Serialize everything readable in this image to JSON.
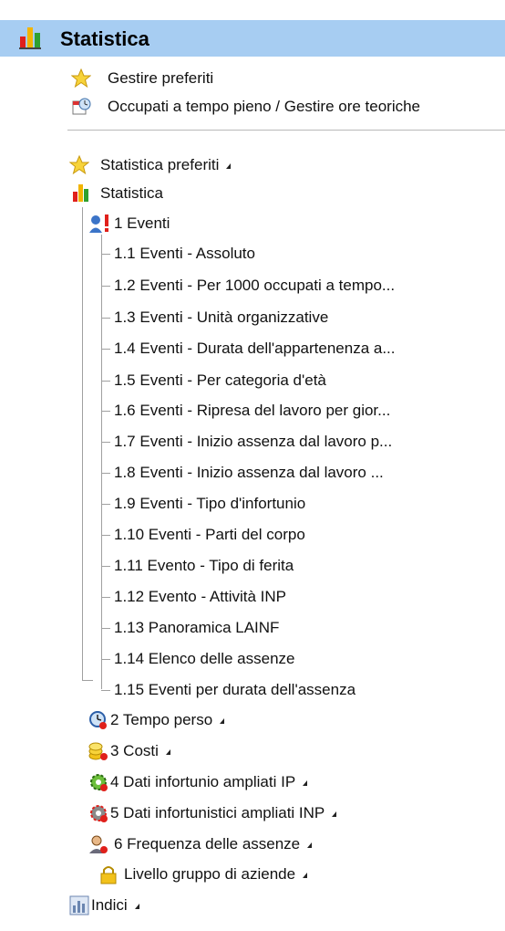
{
  "header": {
    "title": "Statistica"
  },
  "actions": {
    "manage_favorites": "Gestire preferiti",
    "fulltime_hours": "Occupati a tempo pieno / Gestire ore teoriche"
  },
  "tree": {
    "favorites": "Statistica preferiti",
    "statistica": "Statistica",
    "events": "1 Eventi",
    "event_items": [
      "1.1 Eventi - Assoluto",
      "1.2 Eventi - Per 1000 occupati a tempo...",
      "1.3 Eventi - Unità organizzative",
      "1.4 Eventi - Durata dell'appartenenza a...",
      "1.5 Eventi - Per categoria d'età",
      "1.6 Eventi - Ripresa del lavoro per gior...",
      "1.7 Eventi - Inizio assenza dal lavoro p...",
      "1.8 Eventi - Inizio assenza dal lavoro ...",
      "1.9 Eventi - Tipo d'infortunio",
      "1.10 Eventi - Parti del corpo",
      "1.11 Evento - Tipo di ferita",
      "1.12 Evento - Attività INP",
      "1.13 Panoramica LAINF",
      "1.14 Elenco delle assenze",
      "1.15 Eventi per durata dell'assenza"
    ],
    "lost_time": "2 Tempo perso",
    "costs": "3 Costi",
    "ip_data": "4 Dati infortunio ampliati IP",
    "inp_data": "5 Dati infortunistici ampliati INP",
    "absence_freq": "6 Frequenza delle assenze",
    "company_group": "Livello gruppo di aziende",
    "indices": "Indici"
  },
  "colors": {
    "header_bg": "#a7cdf2",
    "tree_line": "#a0a0a0"
  },
  "icons": [
    "bar-chart-icon",
    "star-icon",
    "calendar-clock-icon",
    "person-alert-icon",
    "clock-icon",
    "coins-icon",
    "gears-icon",
    "person-icon",
    "lock-icon",
    "grid-chart-icon",
    "dropdown-arrow-icon"
  ]
}
